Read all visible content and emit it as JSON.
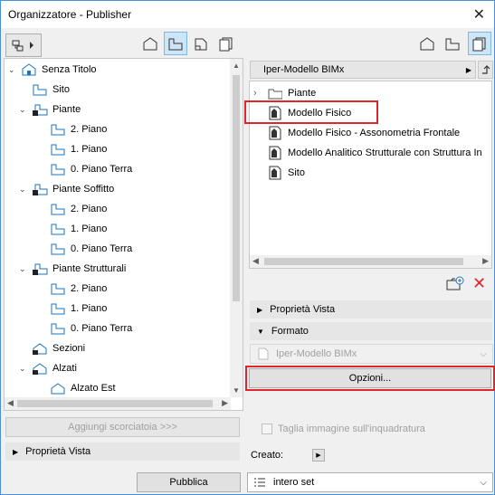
{
  "window": {
    "title": "Organizzatore - Publisher",
    "close_label": "✕"
  },
  "left": {
    "tree": [
      {
        "label": "Senza Titolo",
        "level": 0,
        "expand": "open",
        "icon": "project-icon"
      },
      {
        "label": "Sito",
        "level": 1,
        "expand": "none",
        "icon": "story-icon"
      },
      {
        "label": "Piante",
        "level": 1,
        "expand": "open",
        "icon": "folder-view-icon"
      },
      {
        "label": "2. Piano",
        "level": 2,
        "expand": "none",
        "icon": "story-icon"
      },
      {
        "label": "1. Piano",
        "level": 2,
        "expand": "none",
        "icon": "story-icon"
      },
      {
        "label": "0. Piano Terra",
        "level": 2,
        "expand": "none",
        "icon": "story-icon"
      },
      {
        "label": "Piante Soffitto",
        "level": 1,
        "expand": "open",
        "icon": "folder-view-icon"
      },
      {
        "label": "2. Piano",
        "level": 2,
        "expand": "none",
        "icon": "story-icon"
      },
      {
        "label": "1. Piano",
        "level": 2,
        "expand": "none",
        "icon": "story-icon"
      },
      {
        "label": "0. Piano Terra",
        "level": 2,
        "expand": "none",
        "icon": "story-icon"
      },
      {
        "label": "Piante Strutturali",
        "level": 1,
        "expand": "open",
        "icon": "folder-view-icon"
      },
      {
        "label": "2. Piano",
        "level": 2,
        "expand": "none",
        "icon": "story-icon"
      },
      {
        "label": "1. Piano",
        "level": 2,
        "expand": "none",
        "icon": "story-icon"
      },
      {
        "label": "0. Piano Terra",
        "level": 2,
        "expand": "none",
        "icon": "story-icon"
      },
      {
        "label": "Sezioni",
        "level": 1,
        "expand": "none",
        "icon": "section-icon"
      },
      {
        "label": "Alzati",
        "level": 1,
        "expand": "open",
        "icon": "elevation-icon"
      },
      {
        "label": "Alzato Est",
        "level": 2,
        "expand": "none",
        "icon": "elevation-item-icon"
      }
    ],
    "shortcut_button": "Aggiungi scorciatoia >>>",
    "view_props": "Proprietà Vista",
    "publish_button": "Pubblica"
  },
  "right": {
    "set_name": "Iper-Modello BIMx",
    "items": [
      {
        "label": "Piante",
        "icon": "folder-icon"
      },
      {
        "label": "Modello Fisico",
        "icon": "model-icon"
      },
      {
        "label": "Modello Fisico - Assonometria Frontale",
        "icon": "model-icon"
      },
      {
        "label": "Modello Analitico Strutturale con Struttura In",
        "icon": "model-icon"
      },
      {
        "label": "Sito",
        "icon": "model-icon"
      }
    ],
    "section_view_props": "Proprietà Vista",
    "section_format": "Formato",
    "format_value": "Iper-Modello BIMx",
    "options_button": "Opzioni...",
    "crop_label": "Taglia immagine sull'inquadratura",
    "created_label": "Creato:",
    "set_select": "intero set"
  },
  "colors": {
    "highlight": "#e0262a",
    "selected_bg": "#cde6f7"
  }
}
